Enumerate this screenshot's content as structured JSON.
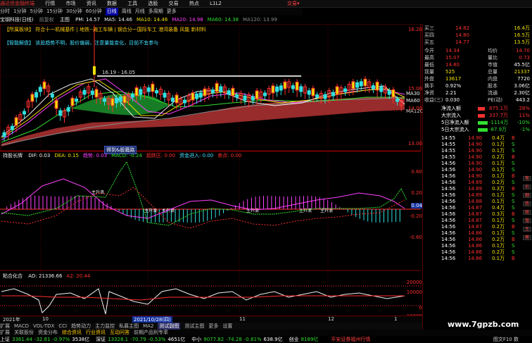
{
  "window": {
    "title": "通达信金融终端",
    "trade_label": "交易▾"
  },
  "menu": [
    "通达信金融终端",
    "行情",
    "市场",
    "资讯",
    "数据",
    "工具",
    "选股",
    "交易",
    "热点",
    "L1L2"
  ],
  "toolbar": [
    "分时",
    "1分钟",
    "5分钟",
    "15分钟",
    "30分钟",
    "60分钟",
    "日线",
    "周线",
    "月线",
    "多周期",
    "更多"
  ],
  "toolbar_active": "日线",
  "main_header": {
    "stock": "宝钢科技(日线)",
    "panel": "前复权",
    "subtitle": "主图",
    "ma_items": [
      {
        "label": "PM: 14.57",
        "color": "#f0f0f0"
      },
      {
        "label": "MA5: 14.46",
        "color": "#f0f0f0"
      },
      {
        "label": "MA10: 14.46",
        "color": "#f0e000"
      },
      {
        "label": "MA20: 14.98",
        "color": "#ff40ff"
      },
      {
        "label": "MA60: 14.38",
        "color": "#30e030"
      },
      {
        "label": "MA120: 13.99",
        "color": "#888888"
      }
    ]
  },
  "ad_line1": "【所属板块】  符合十一机械基件  |  地铁--施工车辆  |  钢合分一国际车工 港湾装备 风能 新材料",
  "ad_line2": "【智能解盘】  该股趋势不明，股价偏弱，注意量能变化，目前不宜参与",
  "price_range_label": "16.19 - 16.05",
  "price_axis": [
    "16.20",
    "15.00",
    "14.00",
    "13.00"
  ],
  "ma_right_labels": [
    "MA30",
    "MA60",
    "MA120"
  ],
  "sub_tip": "得到&股籍路",
  "indicator1": {
    "name": "持股长牌",
    "items": [
      {
        "label": "DIF: 0.03",
        "color": "#f0f0f0"
      },
      {
        "label": "DEA: 0.15",
        "color": "#f0e000"
      },
      {
        "label": "趋势: 0.03",
        "color": "#ff40ff"
      },
      {
        "label": "MACD: -0.24",
        "color": "#30e030"
      },
      {
        "label": "超跌区: 0.00",
        "color": "#ff3030"
      },
      {
        "label": "资金进入: 0.00",
        "color": "#40e0ff"
      },
      {
        "label": "卖点: 0.00",
        "color": "#ff3030"
      }
    ],
    "axis": [
      "0.60",
      "0.20",
      "0.04",
      "-0.20",
      "-0.60"
    ],
    "markers": [
      "主升浪",
      "主升浪",
      "主升浪",
      "主升浪",
      "主升浪",
      "主升浪"
    ]
  },
  "indicator2": {
    "name": "粘合化合",
    "items": [
      {
        "label": "AD: 21336.66",
        "color": "#f0f0f0"
      },
      {
        "label": "A2: 20.44",
        "color": "#ff3030"
      }
    ],
    "axis": [
      "20000",
      "10000",
      "0",
      "-10000"
    ]
  },
  "date_axis": [
    "2021年",
    "10",
    "2021/10/28(四)",
    "11",
    "12",
    "1"
  ],
  "tabs": [
    "扩展",
    "MACD",
    "VOL-TDX",
    "CCI",
    "趋势动力",
    "主力监控",
    "私募主图",
    "MA2",
    "测试副图",
    "测试主图",
    "更多",
    "设置"
  ],
  "tabs_active": "测试副图",
  "bottom_links": [
    "扩展",
    "关联股份",
    "资金分布",
    "综合资讯",
    "行业资讯",
    "互动问答",
    "前期产品利专率"
  ],
  "quote_panel": {
    "asks": [
      {
        "label": "买三",
        "price": "14.82",
        "vol": "16.4万"
      },
      {
        "label": "买四",
        "price": "14.80",
        "vol": "16.5万"
      },
      {
        "label": "买五",
        "price": "14.77",
        "vol": "13.5万"
      }
    ],
    "stats": [
      {
        "l1": "今开",
        "v1": "14.34",
        "l2": "均价",
        "v2": "14.70"
      },
      {
        "l1": "最高",
        "v1": "15.07",
        "l2": "量比",
        "v2": "0.73"
      },
      {
        "l1": "最低",
        "v1": "14.80",
        "l2": "市值",
        "v2": "45.5亿"
      },
      {
        "l1": "现量",
        "v1": "525",
        "l2": "总量",
        "v2": "21337"
      },
      {
        "l1": "外盘",
        "v1": "13617",
        "l2": "内盘",
        "v2": "7720"
      },
      {
        "l1": "换手",
        "v1": "0.92%",
        "l2": "股本",
        "v2": "3.06亿"
      },
      {
        "l1": "净资",
        "v1": "2.21",
        "l2": "流通",
        "v2": "2.30亿"
      },
      {
        "l1": "收益(三)",
        "v1": "0.030",
        "l2": "PE(动)",
        "v2": "443.2"
      }
    ],
    "flows": [
      {
        "label": "净流入额",
        "value": "875.1万",
        "pct": "28%"
      },
      {
        "label": "大宗流入",
        "value": "337.7万",
        "pct": "11%"
      },
      {
        "label": "5日净流入额",
        "value": "-1114万",
        "pct": "-10%"
      },
      {
        "label": "5日大宗流入",
        "value": "-87.9万",
        "pct": "-1%"
      }
    ],
    "ticks": [
      {
        "t": "14:55",
        "p": "14.90",
        "v": "0.4万",
        "s": "B"
      },
      {
        "t": "14:55",
        "p": "14.90",
        "v": "0.1万",
        "s": "S"
      },
      {
        "t": "14:55",
        "p": "14.90",
        "v": "0.1万",
        "s": "S"
      },
      {
        "t": "14:55",
        "p": "14.90",
        "v": "0.2万",
        "s": "B"
      },
      {
        "t": "14:56",
        "p": "14.90",
        "v": "0.1万",
        "s": "S"
      },
      {
        "t": "14:56",
        "p": "14.90",
        "v": "0.1万",
        "s": "S"
      },
      {
        "t": "14:56",
        "p": "14.90",
        "v": "0.1万",
        "s": "B"
      },
      {
        "t": "14:56",
        "p": "14.89",
        "v": "0.2万",
        "s": "S"
      },
      {
        "t": "14:56",
        "p": "14.89",
        "v": "0.3万",
        "s": "B"
      },
      {
        "t": "14:56",
        "p": "14.89",
        "v": "0.1万",
        "s": "S"
      },
      {
        "t": "14:56",
        "p": "14.88",
        "v": "0.1万",
        "s": "S"
      },
      {
        "t": "14:56",
        "p": "14.87",
        "v": "0.4万",
        "s": "S"
      },
      {
        "t": "14:56",
        "p": "14.87",
        "v": "0.3万",
        "s": "B"
      },
      {
        "t": "14:56",
        "p": "14.87",
        "v": "0.1万",
        "s": "S"
      },
      {
        "t": "14:56",
        "p": "14.87",
        "v": "0.2万",
        "s": "B"
      },
      {
        "t": "14:56",
        "p": "14.86",
        "v": "0.1万",
        "s": "S"
      },
      {
        "t": "14:56",
        "p": "14.86",
        "v": "0.2万",
        "s": "B"
      },
      {
        "t": "14:56",
        "p": "14.86",
        "v": "0.1万",
        "s": "S"
      },
      {
        "t": "14:56",
        "p": "14.86",
        "v": "0.2万",
        "s": "S"
      },
      {
        "t": "14:56",
        "p": "14.86",
        "v": "0.1万",
        "s": "B"
      }
    ]
  },
  "right_side_tabs": [
    "笔",
    "价",
    "细",
    "势",
    "联",
    "值",
    "主",
    "筹"
  ],
  "ticker": [
    {
      "label": "上证",
      "value": "3361.44",
      "chg": "-32.81",
      "pct": "-0.97%",
      "amt": "3538亿"
    },
    {
      "label": "深证",
      "value": "13328.1",
      "chg": "-70.79",
      "pct": "-0.53%",
      "amt": "4651亿"
    },
    {
      "label": "中小",
      "value": "9077.82",
      "chg": "-74.28",
      "pct": "-0.81%",
      "amt": "638.9亿"
    },
    {
      "label": "创业",
      "value": "8189亿",
      "chg": "",
      "pct": "",
      "amt": ""
    }
  ],
  "ticker_note": "平安证券福州行情",
  "ticker_end": "图文F10 数",
  "watermark": "www.7gpzb.com",
  "colors": {
    "up": "#ff3030",
    "down": "#30e0e0",
    "bg": "#000000",
    "grid": "#600000",
    "ma5": "#f0f0f0",
    "ma10": "#f0e000",
    "ma20": "#ff40ff",
    "ma60": "#30e030"
  }
}
